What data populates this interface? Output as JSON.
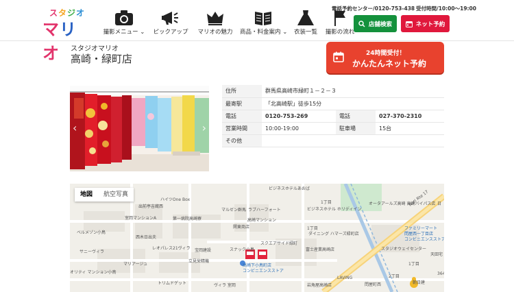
{
  "header": {
    "logo_top": [
      "ス",
      "タ",
      "ジ",
      "オ"
    ],
    "logo_main": [
      "マ",
      "リ",
      "オ"
    ],
    "nav": [
      {
        "label": "撮影メニュー",
        "icon": "camera-icon",
        "dropdown": true
      },
      {
        "label": "ピックアップ",
        "icon": "megaphone-icon",
        "dropdown": false
      },
      {
        "label": "マリオの魅力",
        "icon": "crown-icon",
        "dropdown": false
      },
      {
        "label": "商品・料金案内",
        "icon": "book-icon",
        "dropdown": true
      },
      {
        "label": "衣装一覧",
        "icon": "dress-icon",
        "dropdown": false
      },
      {
        "label": "撮影の流れ",
        "icon": "flag-icon",
        "dropdown": false
      }
    ],
    "phone_info": "電話予約センター/0120-753-438",
    "hours_info": "受付時間/10:00～19:00",
    "store_search": "店舗検索",
    "net_reserve": "ネット予約"
  },
  "store": {
    "brand": "スタジオマリオ",
    "name": "高崎・緑町店"
  },
  "cta": {
    "small": "24時間受付！",
    "big": "かんたんネット予約"
  },
  "info": {
    "address_label": "住所",
    "address": "群馬県高崎市緑町１－２－３",
    "station_label": "最寄駅",
    "station": "「北高崎駅」徒歩15分",
    "tel1_label": "電話",
    "tel1": "0120-753-269",
    "tel2_label": "電話",
    "tel2": "027-370-2310",
    "hours_label": "営業時間",
    "hours": "10:00-19:00",
    "parking_label": "駐車場",
    "parking": "15台",
    "other_label": "その他",
    "other": ""
  },
  "map": {
    "tab_map": "地図",
    "tab_satellite": "航空写真",
    "labels": {
      "l1": "ビジネスホテルあおば",
      "l2": "ハイツOne Box",
      "l3": "出前亭吉蔵西",
      "l4": "室岡マンションA",
      "l5": "マルゼン群馬",
      "l6": "ラブハーフォート",
      "l7": "第一病院高崎寮",
      "l8": "高崎マンション",
      "l9": "関東商店",
      "l10": "ビジネスホテル ホリディイン",
      "l11": "ベルメゾン小鳥",
      "l12": "西木日出夫",
      "l13": "レオパレス21ヴィラ",
      "l14": "宝岡建設",
      "l15": "サニーヴィラ",
      "l16": "マリアージュ",
      "l17": "立見栄精機",
      "l18": "スナック小鳥",
      "l19": "スクエアサイド緑町",
      "l20": "ダイニング ハマーズ緑町店",
      "l21": "富士産業高崎店",
      "l22": "高崎下小鳥町店",
      "l23": "コンビニエンスストア",
      "l24": "トリムドゲット",
      "l25": "ヴィラ 室岡",
      "l26": "オータアールズ高崎 高崎バイパス店",
      "l27": "Natl Rte 17",
      "l28": "ファミリーマート",
      "l29": "問屋西一丁目店",
      "l30": "コンビニエンスストア",
      "l31": "スタジオウェイセンター",
      "l32": "1丁目",
      "l33": "岩角屋高崎店",
      "l34": "問屋町西",
      "l35": "LAVING",
      "l36": "天田宅",
      "l37": "2丁目",
      "l38": "朝日建",
      "l39": "1丁目",
      "l40": "日",
      "l41": "オリティ マンション小鳥",
      "l42": "364",
      "l43": "1丁目"
    }
  },
  "colors": {
    "accent_red": "#e0183c",
    "cta_orange": "#e8422e",
    "green": "#14913c"
  }
}
